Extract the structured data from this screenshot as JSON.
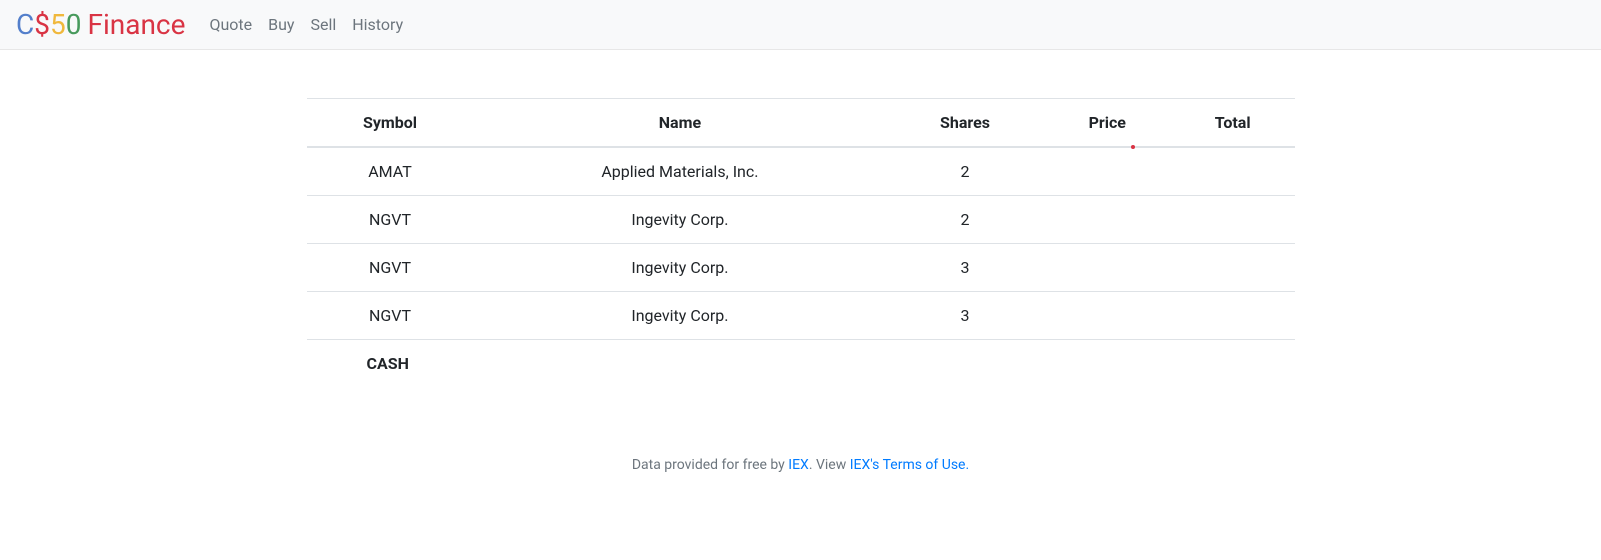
{
  "brand": {
    "c": "C",
    "dollar": "$",
    "five": "5",
    "zero": "0",
    "finance": "Finance"
  },
  "nav": {
    "quote": "Quote",
    "buy": "Buy",
    "sell": "Sell",
    "history": "History"
  },
  "table": {
    "headers": {
      "symbol": "Symbol",
      "name": "Name",
      "shares": "Shares",
      "price": "Price",
      "total": "Total"
    },
    "rows": [
      {
        "symbol": "AMAT",
        "name": "Applied Materials, Inc.",
        "shares": "2",
        "price": "",
        "total": ""
      },
      {
        "symbol": "NGVT",
        "name": "Ingevity Corp.",
        "shares": "2",
        "price": "",
        "total": ""
      },
      {
        "symbol": "NGVT",
        "name": "Ingevity Corp.",
        "shares": "3",
        "price": "",
        "total": ""
      },
      {
        "symbol": "NGVT",
        "name": "Ingevity Corp.",
        "shares": "3",
        "price": "",
        "total": ""
      }
    ],
    "cash_label": "CASH"
  },
  "footer": {
    "prefix": "Data provided for free by ",
    "iex": "IEX",
    "mid": ". View ",
    "terms": "IEX's Terms of Use.",
    "suffix": ""
  }
}
